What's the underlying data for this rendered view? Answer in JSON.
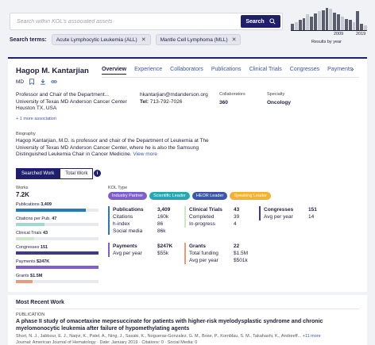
{
  "search": {
    "placeholder": "Search within KOL's associated assets",
    "button_label": "Search",
    "terms_label": "Search terms:",
    "terms": [
      "Acute Lymphocytic Leukemia (ALL)",
      "Mantle Cell Lymphoma (MLL)"
    ]
  },
  "years_chart": {
    "start": "2009",
    "end": "2019",
    "caption": "Results by year",
    "bar_levels": [
      0.3,
      0.35,
      0.45,
      0.55,
      0.7,
      0.6,
      0.75,
      0.85,
      0.9,
      1.0,
      0.95,
      0.8,
      0.7,
      0.6,
      0.5,
      0.45,
      0.35,
      0.85,
      0.3,
      0.2
    ]
  },
  "profile": {
    "name": "Hagop M. Kantarjian",
    "degree": "MD",
    "tabs": [
      "Overview",
      "Experience",
      "Collaborators",
      "Publications",
      "Clinical Trials",
      "Congresses",
      "Payments"
    ],
    "active_tab": "Overview",
    "affiliation": [
      "Professor and Chair of the Department...",
      "University of Texas MD Anderson Cancer Center",
      "Houston TX, USA"
    ],
    "more_association": "+ 1 more association",
    "email": "hkantarjian@mdanderson.org",
    "tel_label": "Tel:",
    "tel": "713-792-7026",
    "collaborators_label": "Collaborators",
    "collaborators": "360",
    "specialty_label": "Specialty",
    "specialty": "Oncology",
    "bio_label": "Biography",
    "bio": "Hagop Kantarjian, M.D. is professor and chair of the Department of Leukemia at The University of Texas MD Anderson Cancer Center, where he is also the Samsung Distinguished Leukemia Chair in Cancer Medicine.",
    "bio_more": "View more"
  },
  "work_toggle": {
    "searched": "Searched Work",
    "total": "Total Work",
    "info": "i"
  },
  "works": {
    "label": "Works",
    "value": "7.2K",
    "metrics": [
      {
        "label": "Publications",
        "value": "3,409",
        "fraction": 0.85,
        "color": "#2b7ab8"
      },
      {
        "label": "Citations per Pub.",
        "value": "47",
        "fraction": 0.35,
        "color": "#9fd9d4"
      },
      {
        "label": "Clinical Trials",
        "value": "43",
        "fraction": 0.22,
        "color": "#cfe6c9"
      },
      {
        "label": "Congresses",
        "value": "151",
        "fraction": 1.0,
        "color": "#3d3a8e"
      },
      {
        "label": "Payments",
        "value": "$247K",
        "fraction": 1.0,
        "color": "#7d63c9"
      },
      {
        "label": "Grants",
        "value": "$1.5M",
        "fraction": 0.2,
        "color": "#e89a7a"
      }
    ]
  },
  "kol": {
    "label": "KOL Type",
    "tags": [
      {
        "text": "Industry Partner",
        "color": "#7d5fc9"
      },
      {
        "text": "Scientific Leader",
        "color": "#28a7b0"
      },
      {
        "text": "HEOR Leader",
        "color": "#3a56a8"
      },
      {
        "text": "Speaking Leader",
        "color": "#f2b233"
      }
    ]
  },
  "stats": {
    "publications": {
      "title": "Publications",
      "value": "3,409",
      "rows": [
        [
          "Citations",
          "160k"
        ],
        [
          "h-index",
          "86"
        ],
        [
          "Social media",
          "86k"
        ]
      ]
    },
    "clinical_trials": {
      "title": "Clinical Trials",
      "value": "43",
      "rows": [
        [
          "Completed",
          "39"
        ],
        [
          "In-progress",
          "4"
        ]
      ]
    },
    "congresses": {
      "title": "Congresses",
      "value": "151",
      "rows": [
        [
          "Avg per year",
          "14"
        ]
      ]
    },
    "payments": {
      "title": "Payments",
      "value": "$247K",
      "rows": [
        [
          "Avg per year",
          "$55k"
        ]
      ]
    },
    "grants": {
      "title": "Grants",
      "value": "22",
      "rows": [
        [
          "Total funding",
          "$1.5M"
        ],
        [
          "Avg per year",
          "$501k"
        ]
      ]
    }
  },
  "recent": {
    "title": "Most Recent Work",
    "type": "PUBLICATION",
    "pub_title": "A phase II study of omacetaxine mepesuccinate for patients with higher-risk myelodysplastic syndrome and chronic myelomonocytic leukemia after failure of hypomethylating agents",
    "authors": "Short, N. J., Jabbour, E. J., Naqvi, K., Patel, A., Ning, J., Sasaki, K., Nogueras-Gonzalez, G. M., Bose, P., Kornblau, S. M., Takahashi, K., Andreeff...",
    "authors_more": "+11 more",
    "journal": "Journal: American Journal of Hematology · Date: January 2019 · Citations: 0 · Social Media: 0"
  }
}
